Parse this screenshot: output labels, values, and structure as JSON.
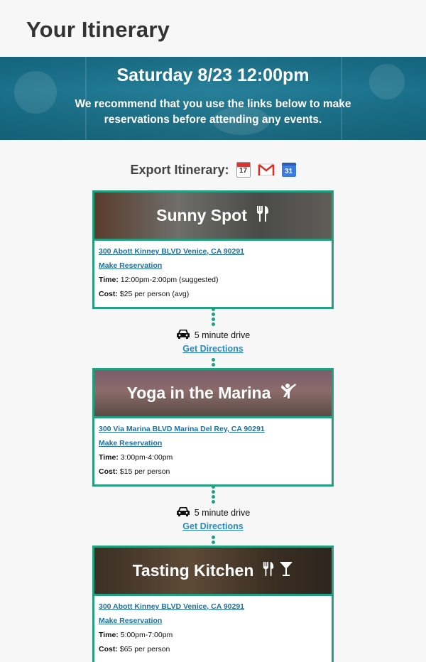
{
  "page": {
    "title": "Your Itinerary"
  },
  "hero": {
    "date": "Saturday 8/23 12:00pm",
    "note": "We recommend that you use the links below to make reservations before attending any events."
  },
  "export": {
    "label": "Export Itinerary:",
    "calendar_day": "17",
    "gcal_day": "31",
    "icons": [
      "ical-icon",
      "gmail-icon",
      "google-calendar-icon"
    ]
  },
  "stops": [
    {
      "title": "Sunny Spot",
      "icons": [
        "restaurant-icon"
      ],
      "address": "300 Abott Kinney BLVD Venice, CA 90291",
      "reservation": "Make Reservation",
      "time_label": "Time:",
      "time": "12:00pm-2:00pm (suggested)",
      "cost_label": "Cost:",
      "cost": "$25 per person (avg)"
    },
    {
      "title": "Yoga in the Marina",
      "icons": [
        "yoga-icon"
      ],
      "address": "300 Via Marina BLVD Marina Del Rey, CA 90291",
      "reservation": "Make Reservation",
      "time_label": "Time:",
      "time": "3:00pm-4:00pm",
      "cost_label": "Cost:",
      "cost": "$15 per person"
    },
    {
      "title": "Tasting Kitchen",
      "icons": [
        "restaurant-icon",
        "cocktail-icon"
      ],
      "address": "300 Abott Kinney BLVD Venice, CA 90291",
      "reservation": "Make Reservation",
      "time_label": "Time:",
      "time": "5:00pm-7:00pm",
      "cost_label": "Cost:",
      "cost": "$65 per person"
    }
  ],
  "legs": [
    {
      "drive": "5 minute drive",
      "directions": "Get Directions",
      "icon": "car-icon"
    },
    {
      "drive": "5 minute drive",
      "directions": "Get Directions",
      "icon": "car-icon"
    }
  ],
  "colors": {
    "accent": "#22a07f",
    "link": "#1f6f9f",
    "hero": "#2c6d82"
  }
}
